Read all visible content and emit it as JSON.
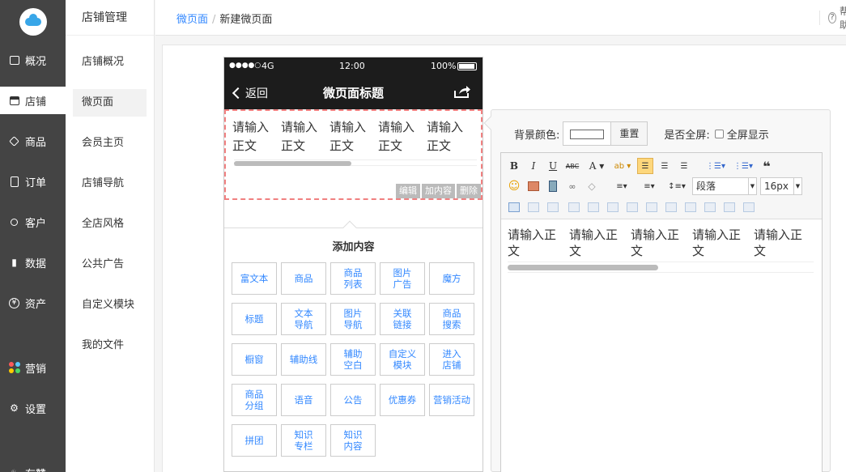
{
  "leftnav": {
    "items": [
      {
        "label": "概况",
        "icon": "dashboard-icon"
      },
      {
        "label": "店铺",
        "icon": "store-icon"
      },
      {
        "label": "商品",
        "icon": "tag-icon"
      },
      {
        "label": "订单",
        "icon": "order-icon"
      },
      {
        "label": "客户",
        "icon": "user-icon"
      },
      {
        "label": "数据",
        "icon": "bar-chart-icon"
      },
      {
        "label": "资产",
        "icon": "yen-icon"
      },
      {
        "label": "营销",
        "icon": "marketing-icon"
      },
      {
        "label": "设置",
        "icon": "gear-icon"
      },
      {
        "label": "有赞",
        "icon": "youzan-icon"
      }
    ]
  },
  "subnav": {
    "title": "店铺管理",
    "items": [
      "店铺概况",
      "微页面",
      "会员主页",
      "店铺导航",
      "全店风格",
      "公共广告",
      "自定义模块",
      "我的文件"
    ]
  },
  "breadcrumb": {
    "parent": "微页面",
    "separator": "/",
    "current": "新建微页面"
  },
  "help": {
    "label": "帮助",
    "icon_char": "?"
  },
  "phone": {
    "status": {
      "signal": "●●●●○",
      "network": "4G",
      "time": "12:00",
      "battery": "100%"
    },
    "back_label": "返回",
    "title": "微页面标题",
    "cells": [
      {
        "line1": "请输入",
        "line2": "正文"
      },
      {
        "line1": "请输入",
        "line2": "正文"
      },
      {
        "line1": "请输入",
        "line2": "正文"
      },
      {
        "line1": "请输入",
        "line2": "正文"
      },
      {
        "line1": "请输入",
        "line2": "正文"
      }
    ],
    "actions": [
      "编辑",
      "加内容",
      "删除"
    ]
  },
  "add_content": {
    "title": "添加内容",
    "buttons": [
      [
        "富文本"
      ],
      [
        "商品"
      ],
      [
        "商品",
        "列表"
      ],
      [
        "图片",
        "广告"
      ],
      [
        "魔方"
      ],
      [
        "标题"
      ],
      [
        "文本",
        "导航"
      ],
      [
        "图片",
        "导航"
      ],
      [
        "关联",
        "链接"
      ],
      [
        "商品",
        "搜索"
      ],
      [
        "橱窗"
      ],
      [
        "辅助线"
      ],
      [
        "辅助",
        "空白"
      ],
      [
        "自定义",
        "模块"
      ],
      [
        "进入",
        "店铺"
      ],
      [
        "商品",
        "分组"
      ],
      [
        "语音"
      ],
      [
        "公告"
      ],
      [
        "优惠券"
      ],
      [
        "营销活动"
      ],
      [
        "拼团"
      ],
      [
        "知识",
        "专栏"
      ],
      [
        "知识",
        "内容"
      ]
    ]
  },
  "editor_panel": {
    "bg_color_label": "背景颜色:",
    "reset_label": "重置",
    "fullscreen_label": "是否全屏:",
    "fullscreen_option": "全屏显示",
    "paragraph_select": "段落",
    "fontsize_select": "16px",
    "cells": [
      {
        "line1": "请输入正",
        "line2": "文"
      },
      {
        "line1": "请输入正",
        "line2": "文"
      },
      {
        "line1": "请输入正",
        "line2": "文"
      },
      {
        "line1": "请输入正",
        "line2": "文"
      },
      {
        "line1": "请输入正",
        "line2": "文"
      }
    ]
  },
  "colors": {
    "accent": "#3388ff",
    "nav_bg": "#444444",
    "phone_bar": "#1c1c1c",
    "edit_border": "#f08080"
  }
}
